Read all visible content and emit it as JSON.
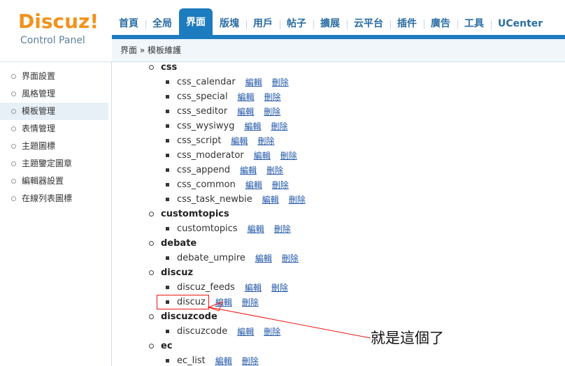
{
  "logo": {
    "brand": "Discuz!",
    "subtitle": "Control Panel"
  },
  "nav": {
    "tabs": [
      "首頁",
      "全局",
      "界面",
      "版塊",
      "用戶",
      "帖子",
      "擴展",
      "云平台",
      "插件",
      "廣告",
      "工具",
      "UCenter"
    ],
    "active": "界面"
  },
  "breadcrumb": "界面 » 模板維護",
  "sidebar": {
    "items": [
      "界面設置",
      "風格管理",
      "模板管理",
      "表情管理",
      "主題圖標",
      "主題鑒定圖章",
      "編輯器設置",
      "在線列表圖標"
    ],
    "active": "模板管理"
  },
  "links": {
    "edit": "編輯",
    "delete": "刪除"
  },
  "groups": [
    {
      "name": "css",
      "items": [
        "css_calendar",
        "css_special",
        "css_seditor",
        "css_wysiwyg",
        "css_script",
        "css_moderator",
        "css_append",
        "css_common",
        "css_task_newbie"
      ]
    },
    {
      "name": "customtopics",
      "items": [
        "customtopics"
      ]
    },
    {
      "name": "debate",
      "items": [
        "debate_umpire"
      ]
    },
    {
      "name": "discuz",
      "items": [
        "discuz_feeds",
        "discuz"
      ]
    },
    {
      "name": "discuzcode",
      "items": [
        "discuzcode"
      ]
    },
    {
      "name": "ec",
      "items": [
        "ec_list"
      ]
    }
  ],
  "annotation": "就是這個了",
  "colors": {
    "brand": "#f2921d",
    "nav_accent": "#1d7bbf",
    "link": "#2056a8",
    "annotation": "#ee1111"
  }
}
